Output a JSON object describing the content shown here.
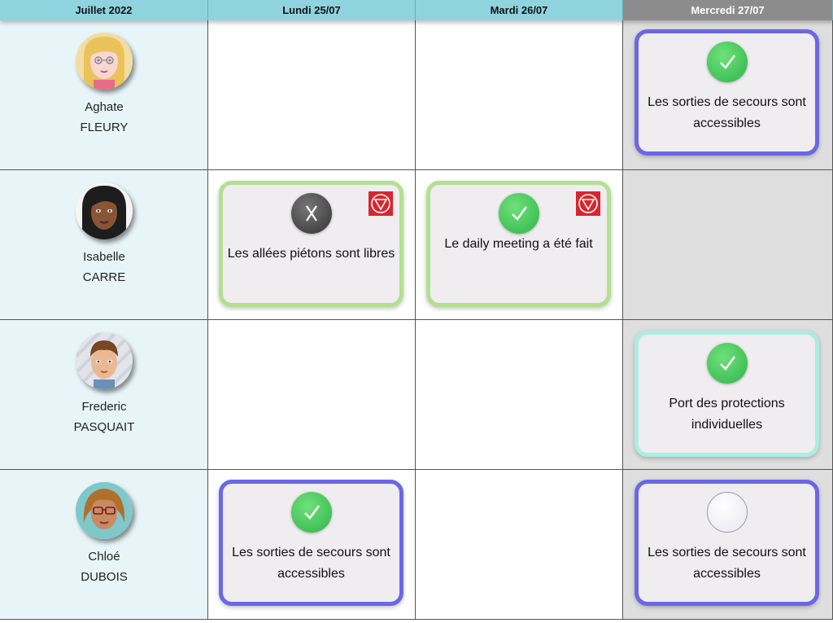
{
  "header": {
    "month": "Juillet 2022",
    "days": [
      "Lundi 25/07",
      "Mardi 26/07",
      "Mercredi 27/07"
    ]
  },
  "rows": [
    {
      "first": "Aghate",
      "last": "FLEURY",
      "cards": {
        "mercredi": {
          "label": "Les sorties de secours sont accessibles",
          "status": "done",
          "border": "#6b67e6"
        }
      }
    },
    {
      "first": "Isabelle",
      "last": "CARRE",
      "cards": {
        "lundi": {
          "label": "Les allées piétons sont libres",
          "status": "failed",
          "border": "#b3e090",
          "flag": "stop-icon"
        },
        "mardi": {
          "label": "Le daily meeting a été fait",
          "status": "done",
          "border": "#b3e090",
          "flag": "stop-icon"
        }
      }
    },
    {
      "first": "Frederic",
      "last": "PASQUAIT",
      "cards": {
        "mercredi": {
          "label": "Port des protections individuelles",
          "status": "done",
          "border": "#a9eee0"
        }
      }
    },
    {
      "first": "Chloé",
      "last": "DUBOIS",
      "cards": {
        "lundi": {
          "label": "Les sorties de secours sont accessibles",
          "status": "done",
          "border": "#6b67e6"
        },
        "mercredi": {
          "label": "Les sorties de secours sont accessibles",
          "status": "pending",
          "border": "#6b67e6"
        }
      }
    }
  ],
  "colors": {
    "header": "#8fd3df",
    "header_today": "#8c8c8c",
    "name_column": "#e8f5f8",
    "today_column": "#dedede",
    "ok": "#3cc04f",
    "stop": "#d8262e"
  }
}
